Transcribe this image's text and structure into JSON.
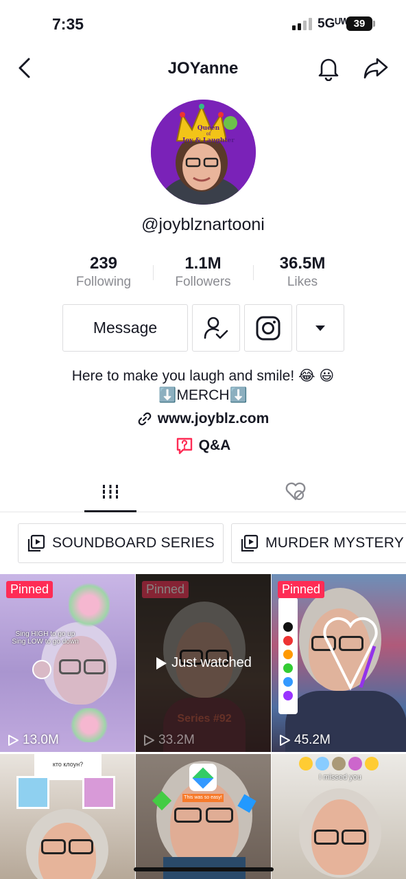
{
  "status_bar": {
    "time": "7:35",
    "network": "5Gᵁᵂ",
    "battery": "39"
  },
  "header": {
    "title": "JOYanne"
  },
  "avatar": {
    "crown_text_1": "Queen",
    "crown_text_2": "of",
    "crown_text_3": "Joy & Laughter"
  },
  "profile": {
    "handle": "@joyblznartooni"
  },
  "stats": [
    {
      "value": "239",
      "label": "Following"
    },
    {
      "value": "1.1M",
      "label": "Followers"
    },
    {
      "value": "36.5M",
      "label": "Likes"
    }
  ],
  "actions": {
    "message_label": "Message",
    "add_friend_icon": "person-check-icon",
    "instagram_icon": "instagram-icon",
    "more_icon": "caret-down-icon"
  },
  "bio": {
    "line1": "Here to make you laugh and smile! 😂 😃",
    "line2": "⬇️MERCH⬇️",
    "link": "www.joyblz.com",
    "qa": "Q&A"
  },
  "tabs": [
    {
      "icon": "videos-grid-icon",
      "active": true
    },
    {
      "icon": "liked-hidden-icon",
      "active": false
    }
  ],
  "playlists": [
    {
      "label": "SOUNDBOARD SERIES"
    },
    {
      "label": "MURDER MYSTERY"
    }
  ],
  "videos": [
    {
      "pinned": "Pinned",
      "views": "13.0M",
      "caption": "Sing HIGH to go up\nSing LOW to go down"
    },
    {
      "pinned": "Pinned",
      "views": "33.2M",
      "watched": "Just watched",
      "overlay_text": "Series #92"
    },
    {
      "pinned": "Pinned",
      "views": "45.2M"
    },
    {
      "caption": "кто клоун?"
    },
    {
      "caption": "This was so easy!"
    },
    {
      "caption": "I missed you"
    }
  ],
  "colors": {
    "pinned": "#fe2c55",
    "text": "#161823",
    "muted": "#8a8b91",
    "avatar_bg": "#7a22b8"
  }
}
